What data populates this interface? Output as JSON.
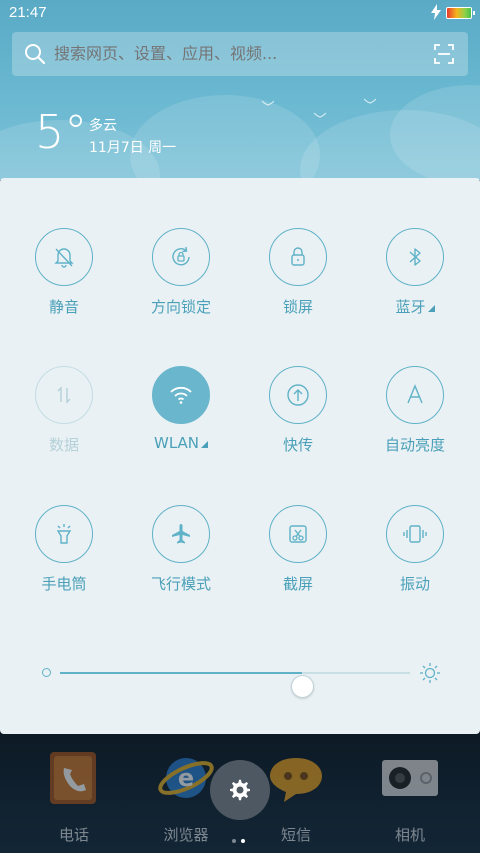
{
  "status_bar": {
    "time": "21:47"
  },
  "search": {
    "placeholder": "搜索网页、设置、应用、视频..."
  },
  "weather": {
    "temperature": "5°",
    "condition": "多云",
    "date": "11月7日 周一"
  },
  "quick_settings": {
    "tiles": [
      {
        "label": "静音",
        "icon": "silent-bell-icon",
        "state": "off"
      },
      {
        "label": "方向锁定",
        "icon": "rotation-lock-icon",
        "state": "off"
      },
      {
        "label": "锁屏",
        "icon": "lock-icon",
        "state": "off"
      },
      {
        "label": "蓝牙",
        "icon": "bluetooth-icon",
        "state": "off",
        "expandable": true
      },
      {
        "label": "数据",
        "icon": "mobile-data-icon",
        "state": "disabled"
      },
      {
        "label": "WLAN",
        "icon": "wifi-icon",
        "state": "on",
        "expandable": true
      },
      {
        "label": "快传",
        "icon": "quick-share-icon",
        "state": "off"
      },
      {
        "label": "自动亮度",
        "icon": "auto-brightness-icon",
        "state": "off"
      },
      {
        "label": "手电筒",
        "icon": "flashlight-icon",
        "state": "off"
      },
      {
        "label": "飞行模式",
        "icon": "airplane-icon",
        "state": "off"
      },
      {
        "label": "截屏",
        "icon": "screenshot-icon",
        "state": "off"
      },
      {
        "label": "振动",
        "icon": "vibrate-icon",
        "state": "off"
      }
    ],
    "brightness": {
      "level": 0.69
    }
  },
  "dock": {
    "apps": [
      {
        "label": "电话",
        "icon": "phone-app-icon"
      },
      {
        "label": "浏览器",
        "icon": "browser-app-icon"
      },
      {
        "label": "短信",
        "icon": "messages-app-icon"
      },
      {
        "label": "相机",
        "icon": "camera-app-icon"
      }
    ],
    "settings_button": "settings-gear-icon",
    "page_indicator": {
      "pages": 2,
      "current": 2
    }
  },
  "colors": {
    "accent": "#5fb2c7",
    "accent_active": "#6ab7cd",
    "panel_bg": "#eaf1f4",
    "header_bg": "#6ab8d1",
    "dock_bg": "#0d1a26"
  }
}
